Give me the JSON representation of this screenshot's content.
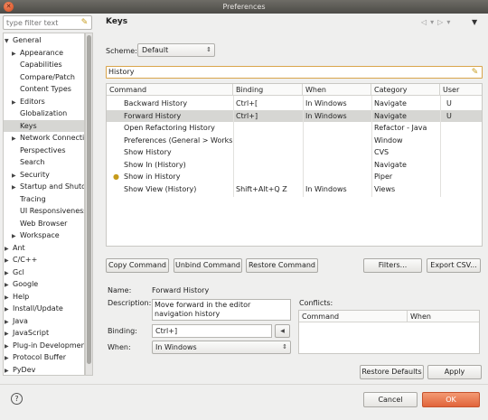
{
  "window": {
    "title": "Preferences"
  },
  "tree": {
    "filter_placeholder": "type filter text",
    "items": [
      {
        "label": "General",
        "level": 0,
        "expander": "▼",
        "selected": false
      },
      {
        "label": "Appearance",
        "level": 1,
        "expander": "▶",
        "selected": false
      },
      {
        "label": "Capabilities",
        "level": 1,
        "expander": "",
        "selected": false
      },
      {
        "label": "Compare/Patch",
        "level": 1,
        "expander": "",
        "selected": false
      },
      {
        "label": "Content Types",
        "level": 1,
        "expander": "",
        "selected": false
      },
      {
        "label": "Editors",
        "level": 1,
        "expander": "▶",
        "selected": false
      },
      {
        "label": "Globalization",
        "level": 1,
        "expander": "",
        "selected": false
      },
      {
        "label": "Keys",
        "level": 1,
        "expander": "",
        "selected": true
      },
      {
        "label": "Network Connectic",
        "level": 1,
        "expander": "▶",
        "selected": false
      },
      {
        "label": "Perspectives",
        "level": 1,
        "expander": "",
        "selected": false
      },
      {
        "label": "Search",
        "level": 1,
        "expander": "",
        "selected": false
      },
      {
        "label": "Security",
        "level": 1,
        "expander": "▶",
        "selected": false
      },
      {
        "label": "Startup and Shutdc",
        "level": 1,
        "expander": "▶",
        "selected": false
      },
      {
        "label": "Tracing",
        "level": 1,
        "expander": "",
        "selected": false
      },
      {
        "label": "UI Responsiveness",
        "level": 1,
        "expander": "",
        "selected": false
      },
      {
        "label": "Web Browser",
        "level": 1,
        "expander": "",
        "selected": false
      },
      {
        "label": "Workspace",
        "level": 1,
        "expander": "▶",
        "selected": false
      },
      {
        "label": "Ant",
        "level": 0,
        "expander": "▶",
        "selected": false
      },
      {
        "label": "C/C++",
        "level": 0,
        "expander": "▶",
        "selected": false
      },
      {
        "label": "Gcl",
        "level": 0,
        "expander": "▶",
        "selected": false
      },
      {
        "label": "Google",
        "level": 0,
        "expander": "▶",
        "selected": false
      },
      {
        "label": "Help",
        "level": 0,
        "expander": "▶",
        "selected": false
      },
      {
        "label": "Install/Update",
        "level": 0,
        "expander": "▶",
        "selected": false
      },
      {
        "label": "Java",
        "level": 0,
        "expander": "▶",
        "selected": false
      },
      {
        "label": "JavaScript",
        "level": 0,
        "expander": "▶",
        "selected": false
      },
      {
        "label": "Plug-in Developmen",
        "level": 0,
        "expander": "▶",
        "selected": false
      },
      {
        "label": "Protocol Buffer",
        "level": 0,
        "expander": "▶",
        "selected": false
      },
      {
        "label": "PyDev",
        "level": 0,
        "expander": "▶",
        "selected": false
      }
    ]
  },
  "page": {
    "title": "Keys"
  },
  "scheme": {
    "label": "Scheme:",
    "value": "Default"
  },
  "command_filter": {
    "value": "History"
  },
  "table": {
    "columns": [
      "Command",
      "Binding",
      "When",
      "Category",
      "User"
    ],
    "rows": [
      {
        "command": "Backward History",
        "binding": "Ctrl+[",
        "when": "In Windows",
        "category": "Navigate",
        "user": "U",
        "selected": false
      },
      {
        "command": "Forward History",
        "binding": "Ctrl+]",
        "when": "In Windows",
        "category": "Navigate",
        "user": "U",
        "selected": true
      },
      {
        "command": "Open Refactoring History",
        "binding": "",
        "when": "",
        "category": "Refactor - Java",
        "user": "",
        "selected": false
      },
      {
        "command": "Preferences (General > Workspace",
        "binding": "",
        "when": "",
        "category": "Window",
        "user": "",
        "selected": false
      },
      {
        "command": "Show History",
        "binding": "",
        "when": "",
        "category": "CVS",
        "user": "",
        "selected": false
      },
      {
        "command": "Show In (History)",
        "binding": "",
        "when": "",
        "category": "Navigate",
        "user": "",
        "selected": false
      },
      {
        "command": "Show in History",
        "binding": "",
        "when": "",
        "category": "Piper",
        "user": "",
        "selected": false
      },
      {
        "command": "Show View (History)",
        "binding": "Shift+Alt+Q Z",
        "when": "In Windows",
        "category": "Views",
        "user": "",
        "selected": false
      }
    ]
  },
  "buttons": {
    "copy": "Copy Command",
    "unbind": "Unbind Command",
    "restore_command": "Restore Command",
    "filters": "Filters...",
    "export": "Export CSV...",
    "restore_defaults": "Restore Defaults",
    "apply": "Apply",
    "cancel": "Cancel",
    "ok": "OK"
  },
  "details": {
    "name_label": "Name:",
    "name_value": "Forward History",
    "description_label": "Description:",
    "description_value": "Move forward in the editor navigation history",
    "binding_label": "Binding:",
    "binding_value": "Ctrl+]",
    "when_label": "When:",
    "when_value": "In Windows"
  },
  "conflicts": {
    "label": "Conflicts:",
    "columns": [
      "Command",
      "When"
    ]
  },
  "colors": {
    "ok_button": "#e1643a",
    "selection": "#d6d6d3",
    "filter_border": "#d9a54b"
  }
}
